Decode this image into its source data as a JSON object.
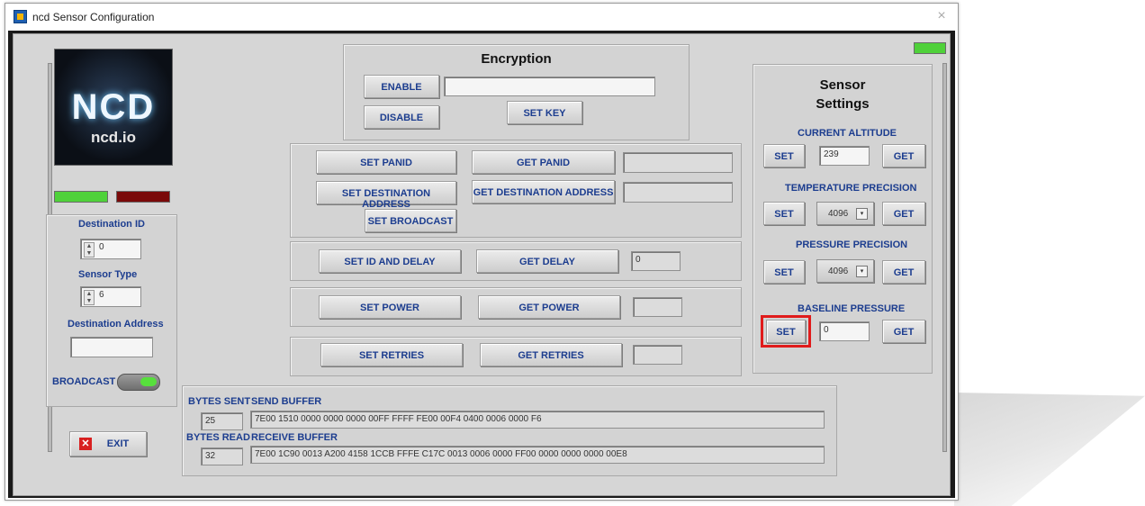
{
  "window": {
    "title": "ncd Sensor Configuration",
    "close": "×"
  },
  "logo": {
    "letters": "NCD",
    "sub": "ncd.io"
  },
  "encryption": {
    "title": "Encryption",
    "enable": "ENABLE",
    "disable": "DISABLE",
    "set_key": "SET KEY",
    "key_value": ""
  },
  "network": {
    "set_panid": "SET PANID",
    "get_panid": "GET PANID",
    "panid_value": "",
    "set_dest": "SET DESTINATION ADDRESS",
    "get_dest": "GET DESTINATION ADDRESS",
    "dest_value": "",
    "set_broadcast": "SET BROADCAST"
  },
  "delay": {
    "set": "SET ID AND DELAY",
    "get": "GET DELAY",
    "value": "0"
  },
  "power": {
    "set": "SET POWER",
    "get": "GET POWER",
    "value": ""
  },
  "retries": {
    "set": "SET RETRIES",
    "get": "GET RETRIES",
    "value": ""
  },
  "left": {
    "dest_id_label": "Destination ID",
    "dest_id_value": "0",
    "sensor_type_label": "Sensor Type",
    "sensor_type_value": "6",
    "dest_addr_label": "Destination Address",
    "dest_addr_value": "",
    "broadcast_label": "BROADCAST",
    "exit": "EXIT"
  },
  "sensor": {
    "title_line1": "Sensor",
    "title_line2": "Settings",
    "altitude_label": "CURRENT ALTITUDE",
    "altitude_value": "239",
    "temp_label": "TEMPERATURE PRECISION",
    "temp_value": "4096",
    "pressure_label": "PRESSURE PRECISION",
    "pressure_value": "4096",
    "baseline_label": "BASELINE PRESSURE",
    "baseline_value": "0",
    "set": "SET",
    "get": "GET"
  },
  "buffers": {
    "bytes_sent_label": "BYTES SENT",
    "bytes_sent": "25",
    "send_label": "SEND BUFFER",
    "send": "7E00 1510 0000 0000 0000 00FF FFFF FE00 00F4 0400 0006 0000 F6",
    "bytes_read_label": "BYTES READ",
    "bytes_read": "32",
    "receive_label": "RECEIVE BUFFER",
    "receive": "7E00 1C90 0013 A200 4158 1CCB FFFE C17C 0013 0006 0000 FF00 0000 0000 0000 00E8"
  },
  "colors": {
    "accent": "#1c3d8f",
    "led_green": "#4fd13a",
    "led_red": "#7a0a0a",
    "highlight": "#e01b1b"
  }
}
